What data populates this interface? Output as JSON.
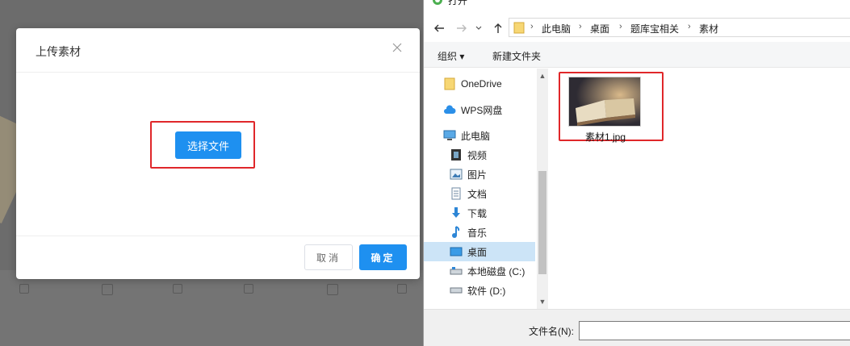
{
  "upload_modal": {
    "title": "上传素材",
    "select_button": "选择文件",
    "cancel_button": "取消",
    "ok_button": "确定"
  },
  "file_dialog": {
    "title": "打开",
    "breadcrumb": [
      "此电脑",
      "桌面",
      "题库宝相关",
      "素材"
    ],
    "toolbar": {
      "organize": "组织 ▾",
      "new_folder": "新建文件夹"
    },
    "nav_items": [
      {
        "label": "OneDrive",
        "icon": "folder-icon"
      },
      {
        "label": "WPS网盘",
        "icon": "cloud-icon"
      },
      {
        "label": "此电脑",
        "icon": "computer-icon"
      },
      {
        "label": "视频",
        "icon": "video-icon"
      },
      {
        "label": "图片",
        "icon": "picture-icon"
      },
      {
        "label": "文档",
        "icon": "document-icon"
      },
      {
        "label": "下载",
        "icon": "download-icon"
      },
      {
        "label": "音乐",
        "icon": "music-icon"
      },
      {
        "label": "桌面",
        "icon": "desktop-icon",
        "selected": true
      },
      {
        "label": "本地磁盘 (C:)",
        "icon": "drive-icon"
      },
      {
        "label": "软件 (D:)",
        "icon": "drive-icon"
      }
    ],
    "files": [
      {
        "name": "素材1.jpg"
      }
    ],
    "filename_label": "文件名(N):",
    "filename_value": ""
  },
  "colors": {
    "primary_button": "#1e90f0",
    "highlight": "#e0272a",
    "nav_selected": "#cce4f7"
  }
}
